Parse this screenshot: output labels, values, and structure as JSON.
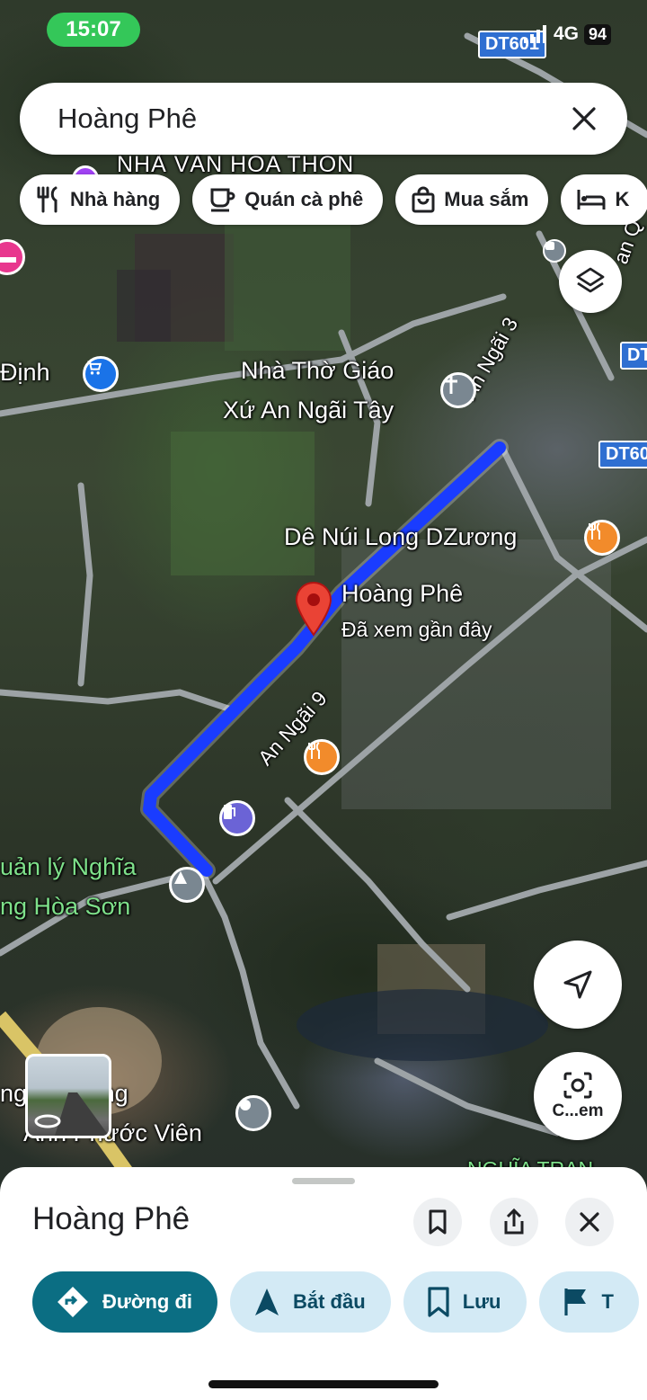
{
  "status": {
    "time": "15:07",
    "network": "4G",
    "battery": "94"
  },
  "search": {
    "query": "Hoàng Phê",
    "close_icon": "close-icon"
  },
  "chips": [
    {
      "label": "Nhà hàng",
      "icon": "restaurant-icon"
    },
    {
      "label": "Quán cà phê",
      "icon": "coffee-icon"
    },
    {
      "label": "Mua sắm",
      "icon": "shopping-bag-icon"
    },
    {
      "label": "K",
      "icon": "hotel-icon"
    }
  ],
  "map": {
    "labels": {
      "village_hall": "NHÀ VĂN HÓA THÔN",
      "dinh": "Định",
      "church_1": "Nhà Thờ Giáo",
      "church_2": "Xứ An Ngãi Tây",
      "road_an_ngai_3": "An Ngãi 3",
      "road_an_ngai_9": "An Ngãi 9",
      "de_nui": "Dê Núi Long DZương",
      "pin_name": "Hoàng Phê",
      "pin_sub": "Đã xem gần đây",
      "cemetery_1": "uản lý Nghĩa",
      "cemetery_2": "ng Hòa Sơn",
      "cremation_1": "ng  hỏa táng",
      "cremation_2": "Ánh Phước Viên",
      "nghia_trang": "NGHĨA TRAN",
      "road_right": "an Q"
    },
    "road_signs": [
      "DT601",
      "DT6",
      "DT60"
    ]
  },
  "camera_button": {
    "label": "C...em"
  },
  "sheet": {
    "title": "Hoàng Phê",
    "actions": [
      {
        "label": "Đường đi",
        "icon": "directions-icon"
      },
      {
        "label": "Bắt đầu",
        "icon": "navigation-arrow-icon"
      },
      {
        "label": "Lưu",
        "icon": "bookmark-icon"
      },
      {
        "label": "T",
        "icon": "flag-icon"
      }
    ]
  },
  "colors": {
    "route": "#1a3cff",
    "pin": "#ea4335",
    "primary_action": "#0b6e83",
    "chip_bg": "#ffffff"
  }
}
